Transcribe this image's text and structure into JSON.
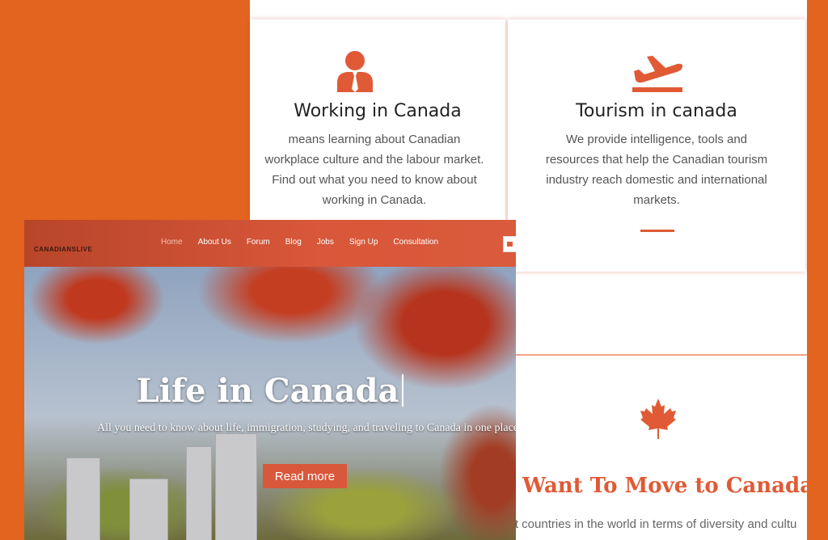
{
  "colors": {
    "accent": "#e05a35",
    "background": "#e2641f"
  },
  "cards": [
    {
      "icon": "person-tie-icon",
      "title": "Working in Canada",
      "lines": [
        "means learning about Canadian",
        "workplace culture and the labour market.",
        "Find out what you need to know about",
        "working in Canada."
      ]
    },
    {
      "icon": "airplane-icon",
      "title": "Tourism in canada",
      "lines": [
        "We provide intelligence, tools and",
        "resources that help the Canadian tourism",
        "industry reach domestic and international",
        "markets."
      ]
    }
  ],
  "move": {
    "icon": "maple-leaf-icon",
    "title": "Want To Move to Canada?",
    "text": "est countries in the world in terms of diversity and cultu"
  },
  "screenshot": {
    "logo": "CANADIANSLIVE",
    "nav": [
      "Home",
      "About Us",
      "Forum",
      "Blog",
      "Jobs",
      "Sign Up",
      "Consultation"
    ],
    "active_nav": "Home",
    "hero_title": "Life in Canada",
    "hero_subtitle": "All you need to know about life, immigration, studying, and traveling to Canada in one place",
    "cta": "Read more"
  }
}
